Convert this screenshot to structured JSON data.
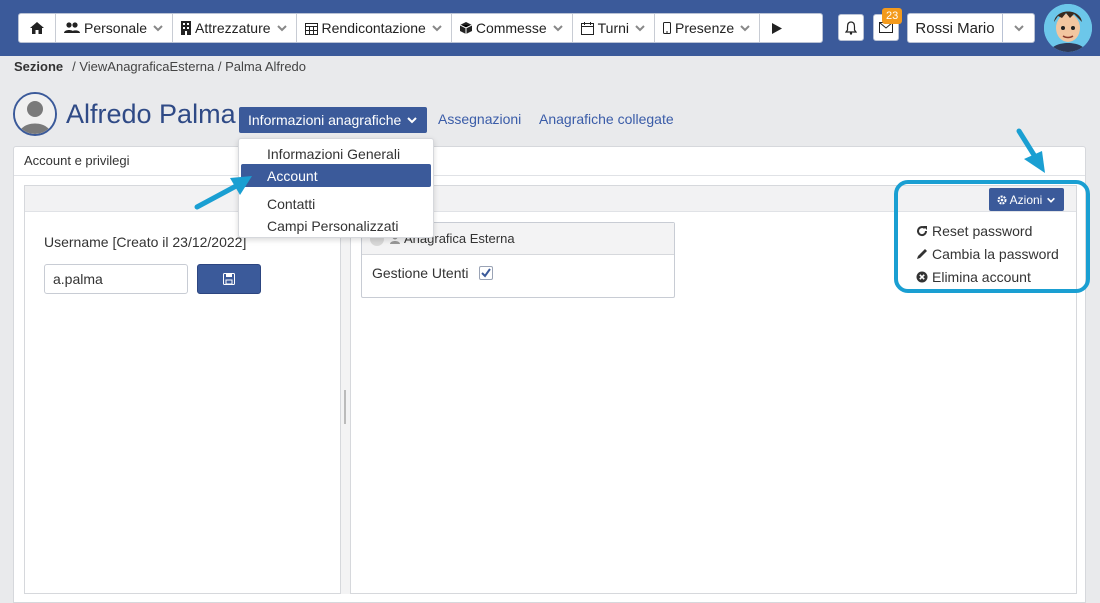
{
  "navbar": {
    "items": [
      {
        "label": "",
        "icon": "home-icon"
      },
      {
        "label": "Personale",
        "icon": "users-icon"
      },
      {
        "label": "Attrezzature",
        "icon": "building-icon"
      },
      {
        "label": "Rendicontazione",
        "icon": "calendar-grid-icon"
      },
      {
        "label": "Commesse",
        "icon": "cube-icon"
      },
      {
        "label": "Turni",
        "icon": "calendar-icon"
      },
      {
        "label": "Presenze",
        "icon": "mobile-icon"
      },
      {
        "label": "",
        "icon": "play-icon"
      }
    ],
    "notifications_icon": "bell-icon",
    "messages_icon": "envelope-icon",
    "messages_badge": "23",
    "user_name": "Rossi Mario"
  },
  "breadcrumb": {
    "section": "Sezione",
    "path": "/ ViewAnagraficaEsterna / Palma Alfredo"
  },
  "header": {
    "name": "Alfredo Palma",
    "active_tab": "Informazioni anagrafiche",
    "tabs": [
      "Assegnazioni",
      "Anagrafiche collegate"
    ]
  },
  "dropdown": {
    "items": [
      "Informazioni Generali",
      "Account",
      "Contatti",
      "Campi Personalizzati"
    ],
    "active_index": 1
  },
  "panel": {
    "title": "Account e privilegi",
    "username_label": "Username [Creato il 23/12/2022]",
    "username_value": "a.palma",
    "ext_box_title": "Anagrafica Esterna",
    "gestione_utenti": "Gestione Utenti",
    "gestione_checked": true
  },
  "actions": {
    "button_label": "Azioni",
    "items": [
      {
        "label": "Reset password",
        "icon": "refresh-icon"
      },
      {
        "label": "Cambia la password",
        "icon": "pencil-icon"
      },
      {
        "label": "Elimina account",
        "icon": "times-circle-icon"
      }
    ]
  },
  "colors": {
    "navbar": "#3b5a9a",
    "accent": "#3b5a9a",
    "highlight": "#1a9fd2",
    "badge": "#f39a1c"
  }
}
